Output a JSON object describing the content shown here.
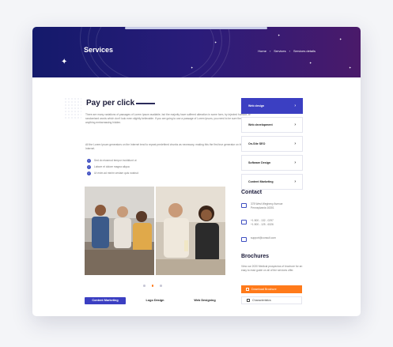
{
  "hero": {
    "title": "Services",
    "breadcrumbs": [
      "Home",
      "Services",
      "Services details"
    ],
    "breadcrumb_separator": "›"
  },
  "content": {
    "title": "Pay per click",
    "paragraph1": "There are many variations of passages of Lorem Ipsum available, but the majority have suffered alteration in some form, by injected humour, or randomised words which don't look even slightly believable. If you are going to use a passage of Lorem Ipsum, you need to be sure there isn't anything embarrassing hidden.",
    "paragraph2": "All the Lorem Ipsum generators on the Internet tend to repeat predefined chunks as necessary, making this the first true generator on the Internet.",
    "bullets": [
      {
        "icon": "check-icon",
        "text": "Sed do eiusmod tempor incididunt ut"
      },
      {
        "icon": "check-icon",
        "text": "Labore et dolore magna aliqua"
      },
      {
        "icon": "check-icon",
        "text": "Ut enim ad minim veniam quis nostrud"
      }
    ]
  },
  "tabs": [
    "Content Marketing",
    "Logo Design",
    "Web Designing"
  ],
  "sidebar": {
    "items": [
      {
        "label": "Web design",
        "active": true
      },
      {
        "label": "Web development",
        "active": false
      },
      {
        "label": "On-Site SEO",
        "active": false
      },
      {
        "label": "Software Design",
        "active": false
      },
      {
        "label": "Content Marketing",
        "active": false
      }
    ],
    "chevron": "›"
  },
  "contact": {
    "heading": "Contact",
    "address": "378 West Wegheny Avenue Pennsylvania 16301",
    "phone1": "+1 800 - 132 - 0297",
    "phone2": "+1 800 - 125 - 6326",
    "email": "support@consult.com"
  },
  "brochures": {
    "heading": "Brochures",
    "description": "View our 2020 Medical prospectus of brochure for an easy to read guide on all of the services offer.",
    "download_label": "Download Brochure",
    "characteristics_label": "Characteristics"
  },
  "colors": {
    "accent": "#3b3fc2",
    "orange": "#ff7a1a"
  }
}
